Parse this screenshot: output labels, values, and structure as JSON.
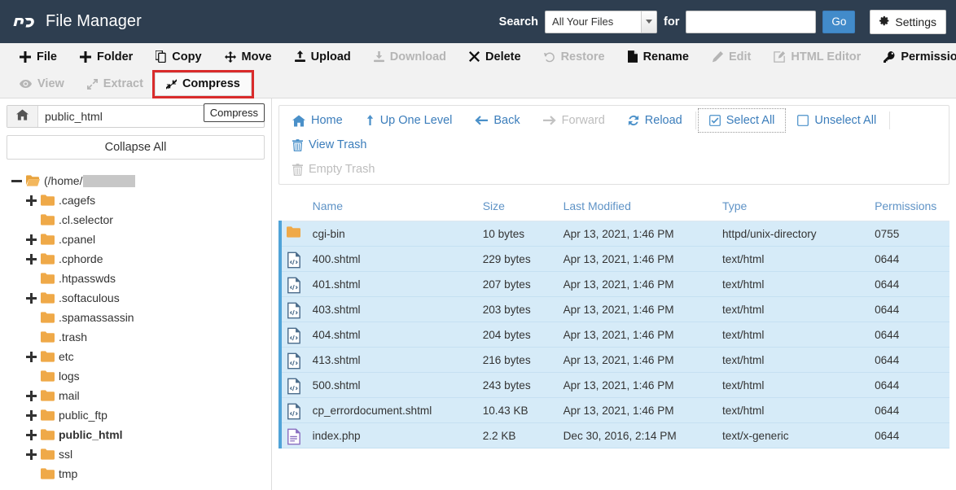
{
  "header": {
    "logo_icon": "cpanel-logo-icon",
    "title": "File Manager",
    "search_label": "Search",
    "search_scope": "All Your Files",
    "search_scope_options": [
      "All Your Files"
    ],
    "for_label": "for",
    "search_value": "",
    "search_placeholder": "",
    "go_label": "Go",
    "settings_label": "Settings",
    "settings_icon": "gear-icon",
    "accent_color": "#428bca",
    "header_bg": "#2e3e50"
  },
  "toolbar": {
    "row1": [
      {
        "label": "File",
        "icon": "plus-icon",
        "disabled": false
      },
      {
        "label": "Folder",
        "icon": "plus-icon",
        "disabled": false
      },
      {
        "label": "Copy",
        "icon": "copy-icon",
        "disabled": false
      },
      {
        "label": "Move",
        "icon": "move-arrows-icon",
        "disabled": false
      },
      {
        "label": "Upload",
        "icon": "upload-icon",
        "disabled": false
      },
      {
        "label": "Download",
        "icon": "download-icon",
        "disabled": true
      },
      {
        "label": "Delete",
        "icon": "x-icon",
        "disabled": false
      },
      {
        "label": "Restore",
        "icon": "restore-icon",
        "disabled": true
      },
      {
        "label": "Rename",
        "icon": "file-icon",
        "disabled": false
      },
      {
        "label": "Edit",
        "icon": "pencil-icon",
        "disabled": true
      },
      {
        "label": "HTML Editor",
        "icon": "html-editor-icon",
        "disabled": true
      },
      {
        "label": "Permissions",
        "icon": "key-icon",
        "disabled": false
      }
    ],
    "row2": [
      {
        "label": "View",
        "icon": "eye-icon",
        "disabled": true,
        "highlighted": false
      },
      {
        "label": "Extract",
        "icon": "extract-arrows-icon",
        "disabled": true,
        "highlighted": false
      },
      {
        "label": "Compress",
        "icon": "compress-arrows-icon",
        "disabled": false,
        "highlighted": true
      }
    ],
    "highlight_color": "#d92b2b"
  },
  "sidebar": {
    "home_icon": "home-icon",
    "path_value": "public_html",
    "path_placeholder": "",
    "tooltip_label": "Compress",
    "collapse_label": "Collapse All",
    "tree": [
      {
        "label": "(/home/",
        "toggle": "minus",
        "indent": 0,
        "bold": false,
        "icon": "open-folder-home-icon",
        "redacted": true
      },
      {
        "label": ".cagefs",
        "toggle": "plus",
        "indent": 1,
        "bold": false,
        "icon": "folder-icon"
      },
      {
        "label": ".cl.selector",
        "toggle": "none",
        "indent": 1,
        "bold": false,
        "icon": "folder-icon"
      },
      {
        "label": ".cpanel",
        "toggle": "plus",
        "indent": 1,
        "bold": false,
        "icon": "folder-icon"
      },
      {
        "label": ".cphorde",
        "toggle": "plus",
        "indent": 1,
        "bold": false,
        "icon": "folder-icon"
      },
      {
        "label": ".htpasswds",
        "toggle": "none",
        "indent": 1,
        "bold": false,
        "icon": "folder-icon"
      },
      {
        "label": ".softaculous",
        "toggle": "plus",
        "indent": 1,
        "bold": false,
        "icon": "folder-icon"
      },
      {
        "label": ".spamassassin",
        "toggle": "none",
        "indent": 1,
        "bold": false,
        "icon": "folder-icon"
      },
      {
        "label": ".trash",
        "toggle": "none",
        "indent": 1,
        "bold": false,
        "icon": "folder-icon"
      },
      {
        "label": "etc",
        "toggle": "plus",
        "indent": 1,
        "bold": false,
        "icon": "folder-icon"
      },
      {
        "label": "logs",
        "toggle": "none",
        "indent": 1,
        "bold": false,
        "icon": "folder-icon"
      },
      {
        "label": "mail",
        "toggle": "plus",
        "indent": 1,
        "bold": false,
        "icon": "folder-icon"
      },
      {
        "label": "public_ftp",
        "toggle": "plus",
        "indent": 1,
        "bold": false,
        "icon": "folder-icon"
      },
      {
        "label": "public_html",
        "toggle": "plus",
        "indent": 1,
        "bold": true,
        "icon": "folder-icon"
      },
      {
        "label": "ssl",
        "toggle": "plus",
        "indent": 1,
        "bold": false,
        "icon": "folder-icon"
      },
      {
        "label": "tmp",
        "toggle": "none",
        "indent": 1,
        "bold": false,
        "icon": "folder-icon"
      }
    ]
  },
  "main": {
    "nav_row1": [
      {
        "label": "Home",
        "icon": "home-icon",
        "disabled": false,
        "focused": false
      },
      {
        "label": "Up One Level",
        "icon": "up-arrow-icon",
        "disabled": false,
        "focused": false
      },
      {
        "label": "Back",
        "icon": "left-arrow-icon",
        "disabled": false,
        "focused": false
      },
      {
        "label": "Forward",
        "icon": "right-arrow-icon",
        "disabled": true,
        "focused": false
      },
      {
        "label": "Reload",
        "icon": "reload-icon",
        "disabled": false,
        "focused": false
      },
      {
        "label": "Select All",
        "icon": "checked-box-icon",
        "disabled": false,
        "focused": true
      },
      {
        "label": "Unselect All",
        "icon": "unchecked-box-icon",
        "disabled": false,
        "focused": false
      },
      {
        "label": "View Trash",
        "icon": "trash-icon",
        "disabled": false,
        "focused": false
      }
    ],
    "nav_row2": [
      {
        "label": "Empty Trash",
        "icon": "trash-icon",
        "disabled": true,
        "focused": false
      }
    ],
    "columns": [
      "Name",
      "Size",
      "Last Modified",
      "Type",
      "Permissions"
    ],
    "rows": [
      {
        "icon": "folder-icon",
        "name": "cgi-bin",
        "size": "10 bytes",
        "modified": "Apr 13, 2021, 1:46 PM",
        "type": "httpd/unix-directory",
        "permissions": "0755",
        "selected": true
      },
      {
        "icon": "html-file-icon",
        "name": "400.shtml",
        "size": "229 bytes",
        "modified": "Apr 13, 2021, 1:46 PM",
        "type": "text/html",
        "permissions": "0644",
        "selected": true
      },
      {
        "icon": "html-file-icon",
        "name": "401.shtml",
        "size": "207 bytes",
        "modified": "Apr 13, 2021, 1:46 PM",
        "type": "text/html",
        "permissions": "0644",
        "selected": true
      },
      {
        "icon": "html-file-icon",
        "name": "403.shtml",
        "size": "203 bytes",
        "modified": "Apr 13, 2021, 1:46 PM",
        "type": "text/html",
        "permissions": "0644",
        "selected": true
      },
      {
        "icon": "html-file-icon",
        "name": "404.shtml",
        "size": "204 bytes",
        "modified": "Apr 13, 2021, 1:46 PM",
        "type": "text/html",
        "permissions": "0644",
        "selected": true
      },
      {
        "icon": "html-file-icon",
        "name": "413.shtml",
        "size": "216 bytes",
        "modified": "Apr 13, 2021, 1:46 PM",
        "type": "text/html",
        "permissions": "0644",
        "selected": true
      },
      {
        "icon": "html-file-icon",
        "name": "500.shtml",
        "size": "243 bytes",
        "modified": "Apr 13, 2021, 1:46 PM",
        "type": "text/html",
        "permissions": "0644",
        "selected": true
      },
      {
        "icon": "html-file-icon",
        "name": "cp_errordocument.shtml",
        "size": "10.43 KB",
        "modified": "Apr 13, 2021, 1:46 PM",
        "type": "text/html",
        "permissions": "0644",
        "selected": true
      },
      {
        "icon": "generic-file-icon",
        "name": "index.php",
        "size": "2.2 KB",
        "modified": "Dec 30, 2016, 2:14 PM",
        "type": "text/x-generic",
        "permissions": "0644",
        "selected": true
      }
    ],
    "row_selected_color": "#d6ebf8",
    "row_marker_color": "#4fa3d8"
  }
}
